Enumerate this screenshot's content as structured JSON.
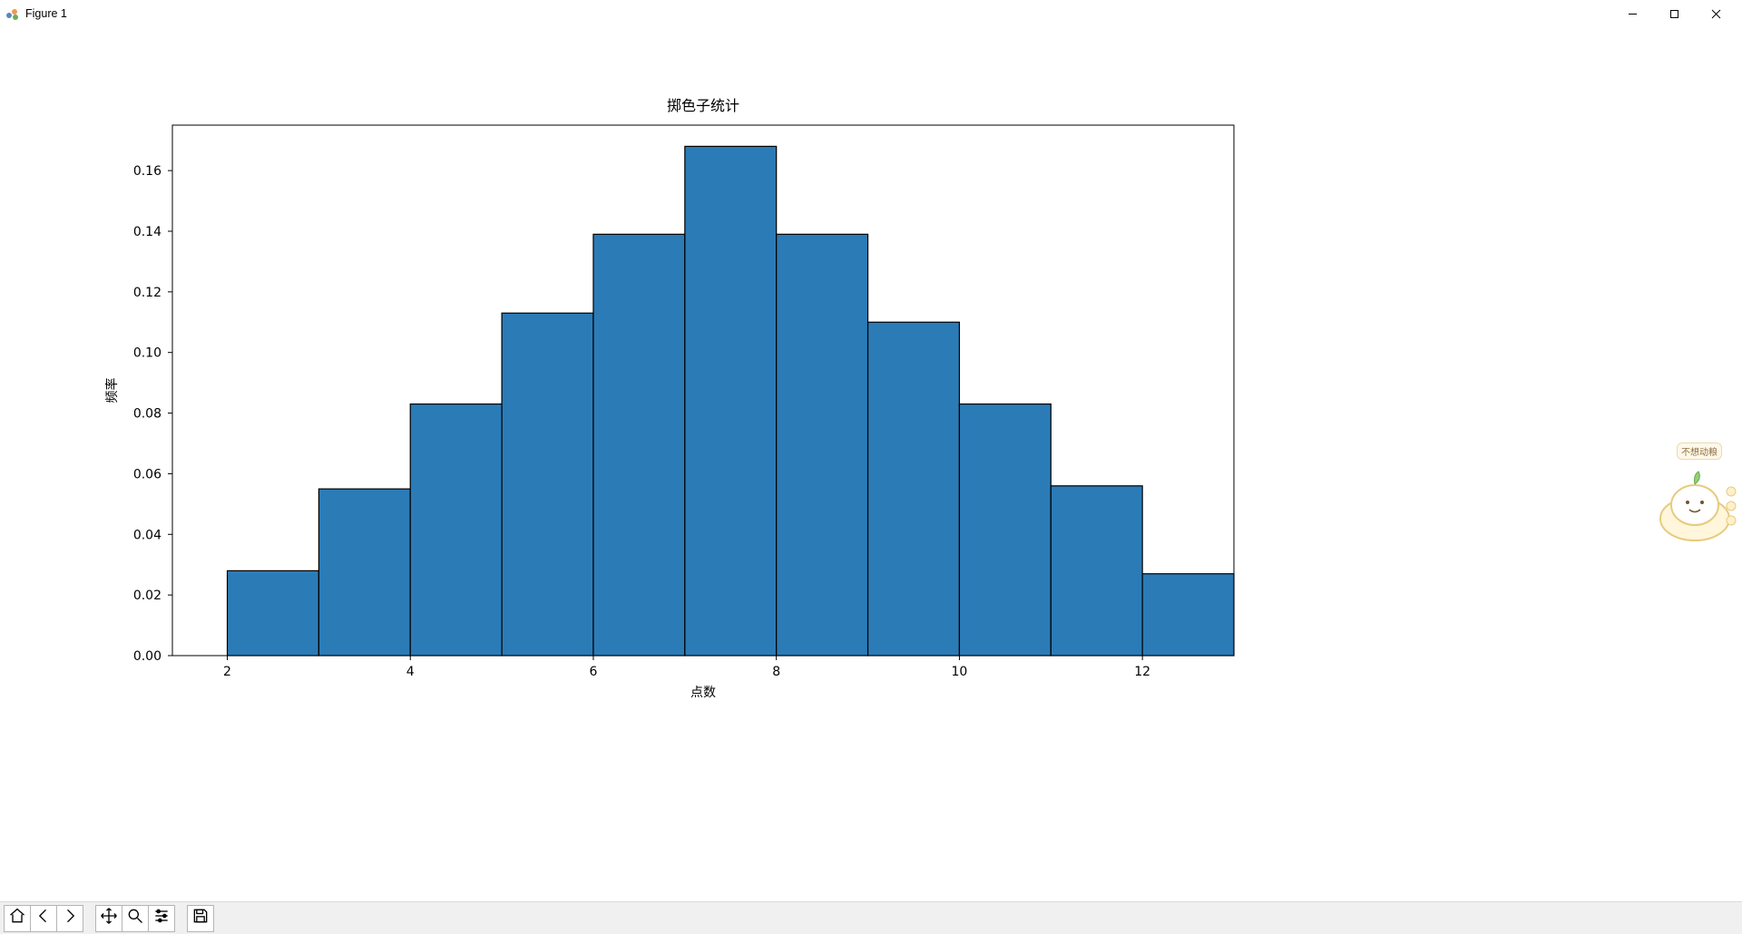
{
  "window": {
    "title": "Figure 1"
  },
  "window_controls": {
    "minimize_name": "minimize",
    "maximize_name": "maximize",
    "close_name": "close"
  },
  "toolbar": {
    "home": "Home",
    "back": "Back",
    "forward": "Forward",
    "pan": "Pan",
    "zoom": "Zoom",
    "configure": "Configure subplots",
    "save": "Save"
  },
  "mascot_text": "不想动粮",
  "chart_data": {
    "type": "bar",
    "categories": [
      2,
      3,
      4,
      5,
      6,
      7,
      8,
      9,
      10,
      11,
      12
    ],
    "values": [
      0.028,
      0.055,
      0.083,
      0.113,
      0.139,
      0.168,
      0.139,
      0.11,
      0.083,
      0.056,
      0.027
    ],
    "title": "掷色子统计",
    "xlabel": "点数",
    "ylabel": "频率",
    "xlim": [
      1.4,
      13.0
    ],
    "ylim": [
      0.0,
      0.175
    ],
    "xticks": [
      2,
      4,
      6,
      8,
      10,
      12
    ],
    "yticks": [
      0.0,
      0.02,
      0.04,
      0.06,
      0.08,
      0.1,
      0.12,
      0.14,
      0.16
    ],
    "ytick_labels": [
      "0.00",
      "0.02",
      "0.04",
      "0.06",
      "0.08",
      "0.10",
      "0.12",
      "0.14",
      "0.16"
    ],
    "bar_color": "#2b7bb7",
    "bar_edge": "#000000"
  }
}
